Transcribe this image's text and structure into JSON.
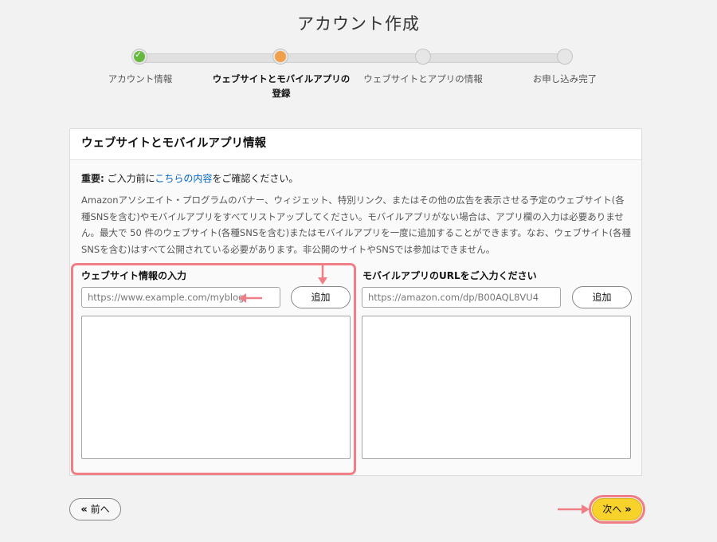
{
  "page": {
    "title": "アカウント作成"
  },
  "stepper": {
    "steps": [
      {
        "label": "アカウント情報",
        "state": "done"
      },
      {
        "label_line1": "ウェブサイトとモバイルアプリの",
        "label_line2": "登録",
        "state": "current"
      },
      {
        "label": "ウェブサイトとアプリの情報",
        "state": "todo"
      },
      {
        "label": "お申し込み完了",
        "state": "todo"
      }
    ]
  },
  "panel": {
    "title": "ウェブサイトとモバイルアプリ情報",
    "important_prefix": "重要:",
    "important_mid": " ご入力前に",
    "important_link": "こちらの内容",
    "important_suffix": "をご確認ください。",
    "description": "Amazonアソシエイト・プログラムのバナー、ウィジェット、特別リンク、またはその他の広告を表示させる予定のウェブサイト(各種SNSを含む)やモバイルアプリをすべてリストアップしてください。モバイルアプリがない場合は、アプリ欄の入力は必要ありません。最大で 50 件のウェブサイト(各種SNSを含む)またはモバイルアプリを一度に追加することができます。なお、ウェブサイト(各種SNSを含む)はすべて公開されている必要があります。非公開のサイトやSNSでは参加はできません。"
  },
  "website": {
    "title": "ウェブサイト情報の入力",
    "placeholder": "https://www.example.com/myblog",
    "add_label": "追加"
  },
  "mobile": {
    "title": "モバイルアプリのURLをご入力ください",
    "placeholder": "https://amazon.com/dp/B00AQL8VU4",
    "add_label": "追加"
  },
  "nav": {
    "prev_label": "前へ",
    "next_label": "次へ"
  },
  "colors": {
    "highlight": "#f07e86",
    "done": "#67b83e",
    "current": "#f0a04b",
    "next_button": "#f7d22b",
    "link": "#0066c0"
  },
  "icons": {
    "done_step": "check-icon",
    "prev": "double-chevron-left-icon",
    "next": "double-chevron-right-icon",
    "annotation": "arrow-icon"
  }
}
